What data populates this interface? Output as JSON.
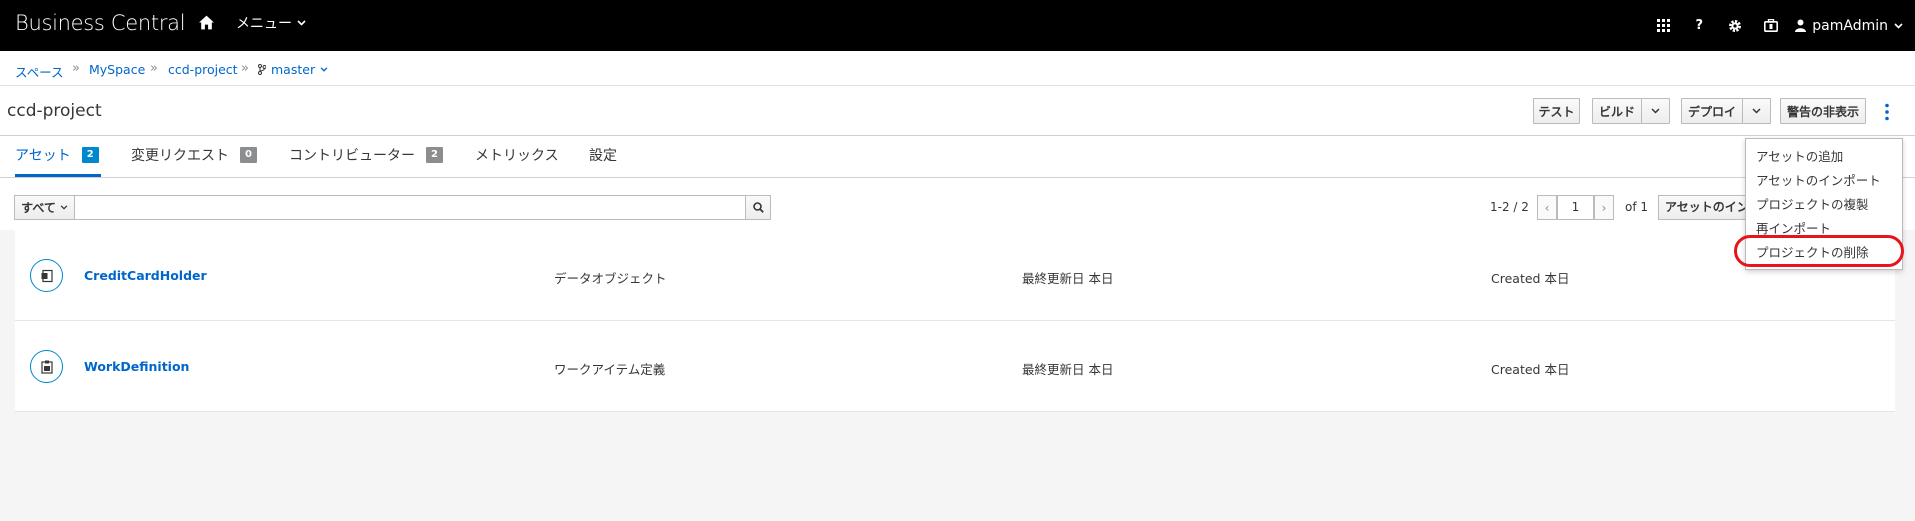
{
  "header": {
    "brand": "Business Central",
    "menu_label": "メニュー",
    "user_name": "pamAdmin"
  },
  "breadcrumb": {
    "items": [
      "スペース",
      "MySpace",
      "ccd-project"
    ],
    "branch": "master",
    "separator": "»"
  },
  "title_bar": {
    "title": "ccd-project",
    "test_label": "テスト",
    "build_label": "ビルド",
    "deploy_label": "デプロイ",
    "hide_alerts_label": "警告の非表示"
  },
  "tabs": [
    {
      "label": "アセット",
      "badge": "2"
    },
    {
      "label": "変更リクエスト",
      "badge": "0"
    },
    {
      "label": "コントリビューター",
      "badge": "2"
    },
    {
      "label": "メトリックス",
      "badge": ""
    },
    {
      "label": "設定",
      "badge": ""
    }
  ],
  "toolbar": {
    "filter_label": "すべて",
    "search_value": "",
    "range_text": "1-2 / 2",
    "page_value": "1",
    "of_text": "of 1",
    "import_label": "アセットのインポート"
  },
  "assets": [
    {
      "name": "CreditCardHolder",
      "type": "データオブジェクト",
      "modified": "最終更新日 本日",
      "created": "Created 本日",
      "icon": "data-object-icon"
    },
    {
      "name": "WorkDefinition",
      "type": "ワークアイテム定義",
      "modified": "最終更新日 本日",
      "created": "Created 本日",
      "icon": "work-item-icon"
    }
  ],
  "kebab_menu": {
    "items": [
      "アセットの追加",
      "アセットのインポート",
      "プロジェクトの複製",
      "再インポート",
      "プロジェクトの削除"
    ],
    "highlighted": "プロジェクトの削除"
  },
  "colors": {
    "topbar": "#000000",
    "link": "#0066cc",
    "badge_active": "#0088ce",
    "badge": "#8b8d8f",
    "highlight": "#e8141c"
  }
}
